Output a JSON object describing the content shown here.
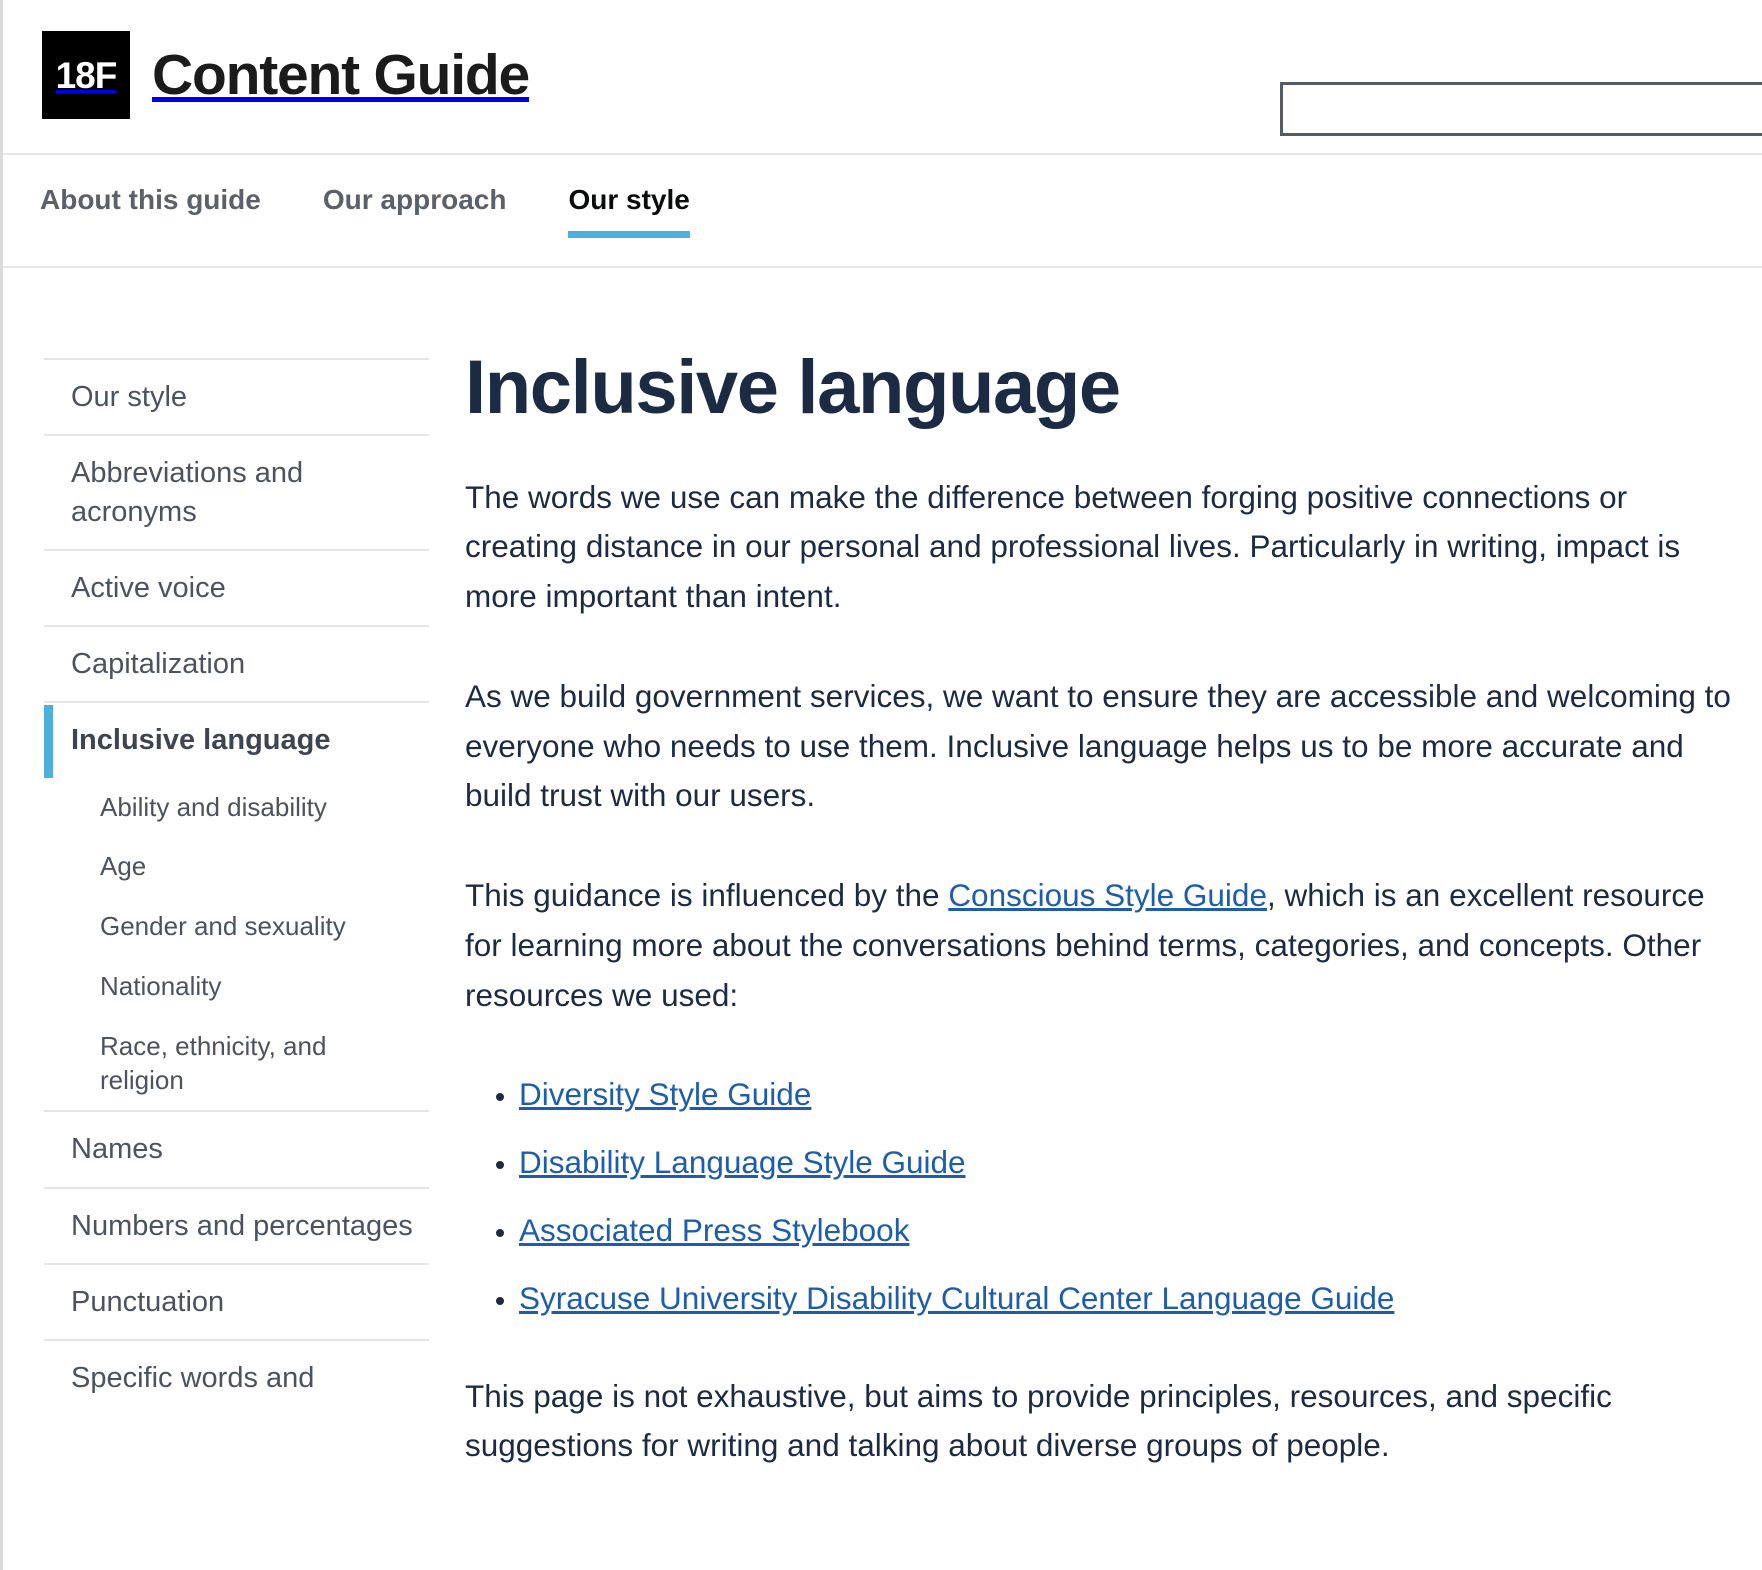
{
  "header": {
    "logo_text": "18F",
    "title": "Content Guide",
    "search": {
      "value": "",
      "placeholder": ""
    }
  },
  "primary_nav": {
    "items": [
      {
        "label": "About this guide",
        "active": false
      },
      {
        "label": "Our approach",
        "active": false
      },
      {
        "label": "Our style",
        "active": true
      }
    ]
  },
  "sidebar": {
    "items": [
      {
        "label": "Our style",
        "level": "top",
        "active": false
      },
      {
        "label": "Abbreviations and acronyms",
        "level": "top",
        "active": false
      },
      {
        "label": "Active voice",
        "level": "top",
        "active": false
      },
      {
        "label": "Capitalization",
        "level": "top",
        "active": false
      },
      {
        "label": "Inclusive language",
        "level": "top",
        "active": true
      },
      {
        "label": "Ability and disability",
        "level": "sub",
        "active": false
      },
      {
        "label": "Age",
        "level": "sub",
        "active": false
      },
      {
        "label": "Gender and sexuality",
        "level": "sub",
        "active": false
      },
      {
        "label": "Nationality",
        "level": "sub",
        "active": false
      },
      {
        "label": "Race, ethnicity, and religion",
        "level": "sub",
        "active": false
      },
      {
        "label": "Names",
        "level": "top",
        "active": false
      },
      {
        "label": "Numbers and percentages",
        "level": "top",
        "active": false
      },
      {
        "label": "Punctuation",
        "level": "top",
        "active": false
      },
      {
        "label": "Specific words and",
        "level": "top",
        "active": false
      }
    ]
  },
  "main": {
    "title": "Inclusive language",
    "paragraph_1": "The words we use can make the difference between forging positive connections or creating distance in our personal and professional lives. Particularly in writing, impact is more important than intent.",
    "paragraph_2": "As we build government services, we want to ensure they are accessible and welcoming to everyone who needs to use them. Inclusive language helps us to be more accurate and build trust with our users.",
    "paragraph_3": {
      "before_link": "This guidance is influenced by the ",
      "link_text": "Conscious Style Guide",
      "after_link": ", which is an excellent resource for learning more about the conversations behind terms, categories, and concepts. Other resources we used:"
    },
    "resources": [
      "Diversity Style Guide",
      "Disability Language Style Guide",
      "Associated Press Stylebook",
      "Syracuse University Disability Cultural Center Language Guide"
    ],
    "paragraph_4": "This page is not exhaustive, but aims to provide principles, resources, and specific suggestions for writing and talking about diverse groups of people."
  },
  "colors": {
    "accent_blue": "#4fafdc",
    "link_blue": "#1d5daa",
    "heading_navy": "#1b2b44",
    "logo_black": "#000000"
  }
}
